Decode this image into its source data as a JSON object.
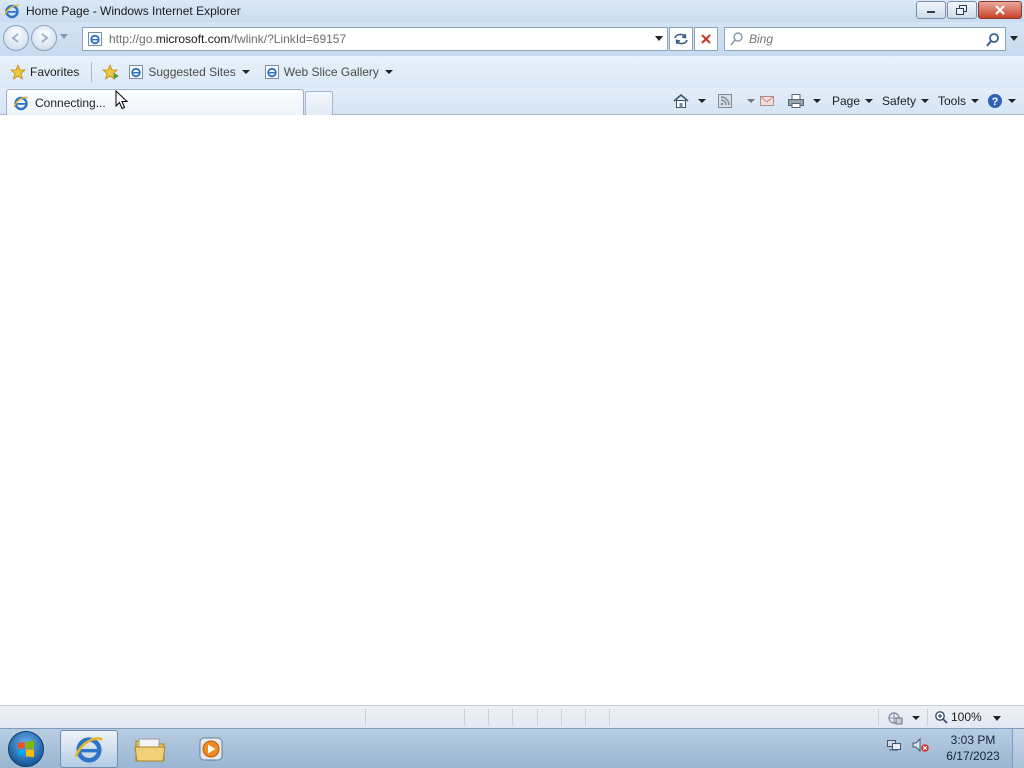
{
  "window": {
    "title": "Home Page - Windows Internet Explorer",
    "address_prefix": "http://go.",
    "address_domain": "microsoft.com",
    "address_suffix": "/fwlink/?LinkId=69157",
    "search_placeholder": "Bing"
  },
  "favorites_bar": {
    "favorites_label": "Favorites",
    "items": [
      {
        "label": "Suggested Sites",
        "icon": "ie-page-icon"
      },
      {
        "label": "Web Slice Gallery",
        "icon": "ie-page-icon"
      }
    ]
  },
  "tabs": [
    {
      "label": "Connecting...",
      "active": true
    }
  ],
  "command_bar": {
    "items": [
      "Page",
      "Safety",
      "Tools"
    ]
  },
  "status_bar": {
    "zoom": "100%"
  },
  "taskbar": {
    "time": "3:03 PM",
    "date": "6/17/2023"
  },
  "colors": {
    "chrome_blue": "#c9dcf0",
    "close_red": "#c5432c",
    "taskbar_blue": "#9ab6d2"
  }
}
